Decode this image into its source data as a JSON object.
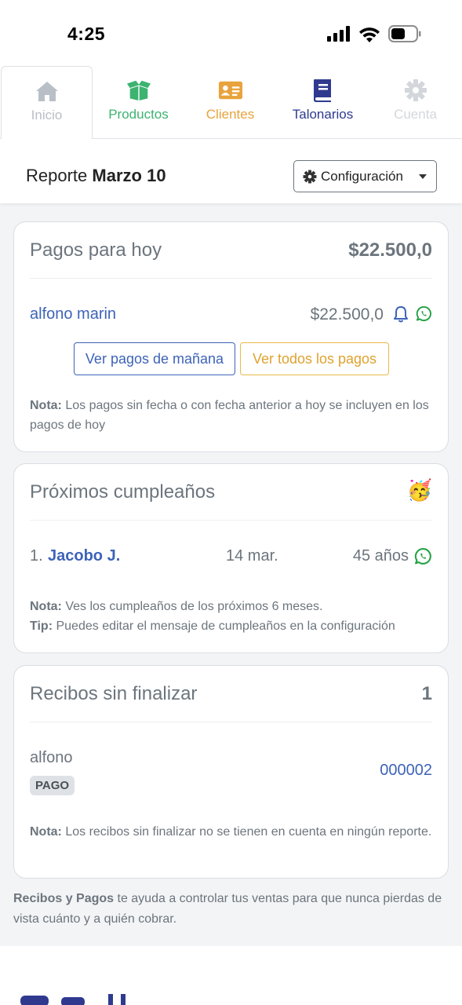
{
  "status_bar": {
    "time": "4:25"
  },
  "tabs": [
    {
      "label": "Inicio",
      "icon": "home-icon",
      "color": "#b9bfc7",
      "active": true
    },
    {
      "label": "Productos",
      "icon": "box-open-icon",
      "color": "#3cb371"
    },
    {
      "label": "Clientes",
      "icon": "address-card-icon",
      "color": "#e8a33d"
    },
    {
      "label": "Talonarios",
      "icon": "book-icon",
      "color": "#2f3a8f"
    },
    {
      "label": "Cuenta",
      "icon": "gear-icon",
      "color": "#d3d7dc"
    }
  ],
  "report": {
    "prefix": "Reporte",
    "date": "Marzo 10",
    "config_label": "Configuración"
  },
  "payments_today": {
    "title": "Pagos para hoy",
    "total": "$22.500,0",
    "items": [
      {
        "client": "alfono marin",
        "amount": "$22.500,0"
      }
    ],
    "btn_tomorrow": "Ver pagos de mañana",
    "btn_all": "Ver todos los pagos",
    "note_label": "Nota:",
    "note_text": " Los pagos sin fecha o con fecha anterior a hoy se incluyen en los pagos de hoy"
  },
  "birthdays": {
    "title": "Próximos cumpleaños",
    "emoji": "🥳",
    "items": [
      {
        "index": "1.",
        "name": "Jacobo J.",
        "date": "14 mar.",
        "age": "45 años"
      }
    ],
    "note_label": "Nota:",
    "note_text": " Ves los cumpleaños de los próximos 6 meses.",
    "tip_label": "Tip:",
    "tip_text": " Puedes editar el mensaje de cumpleaños en la configuración"
  },
  "unfinished": {
    "title": "Recibos sin finalizar",
    "count": "1",
    "items": [
      {
        "client": "alfono",
        "badge": "PAGO",
        "number": "000002"
      }
    ],
    "note_label": "Nota:",
    "note_text": " Los recibos sin finalizar no se tienen en cuenta en ningún reporte."
  },
  "footer": {
    "brand": "Recibos y Pagos",
    "text": " te ayuda a controlar tus ventas para que nunca pierdas de vista cuánto y a quién cobrar."
  },
  "colors": {
    "blue": "#3d63b8",
    "yellow": "#e8a33d",
    "green": "#25a244",
    "muted": "#6c757d"
  }
}
